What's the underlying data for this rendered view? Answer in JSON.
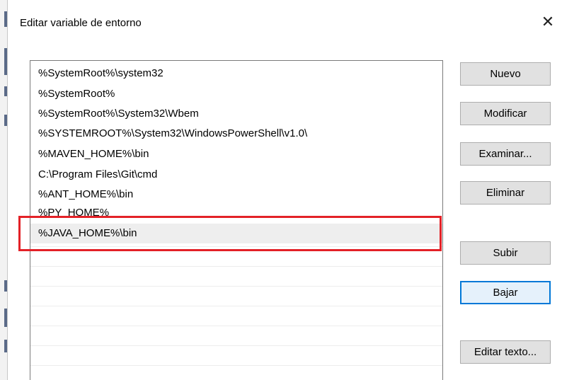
{
  "window": {
    "title": "Editar variable de entorno",
    "close_glyph": "✕"
  },
  "path_list": {
    "items": [
      "%SystemRoot%\\system32",
      "%SystemRoot%",
      "%SystemRoot%\\System32\\Wbem",
      "%SYSTEMROOT%\\System32\\WindowsPowerShell\\v1.0\\",
      "%MAVEN_HOME%\\bin",
      "C:\\Program Files\\Git\\cmd",
      "%ANT_HOME%\\bin",
      "%PY_HOME%",
      "%JAVA_HOME%\\bin"
    ],
    "selected_index": 8
  },
  "buttons": {
    "nuevo": "Nuevo",
    "modificar": "Modificar",
    "examinar": "Examinar...",
    "eliminar": "Eliminar",
    "subir": "Subir",
    "bajar": "Bajar",
    "editar_texto": "Editar texto..."
  },
  "colors": {
    "annotation_frame": "#e32127",
    "focus_border": "#0078d7",
    "selected_row": "#eeeeee",
    "button_face": "#e1e1e1"
  },
  "icons": {
    "close": "close-icon"
  }
}
